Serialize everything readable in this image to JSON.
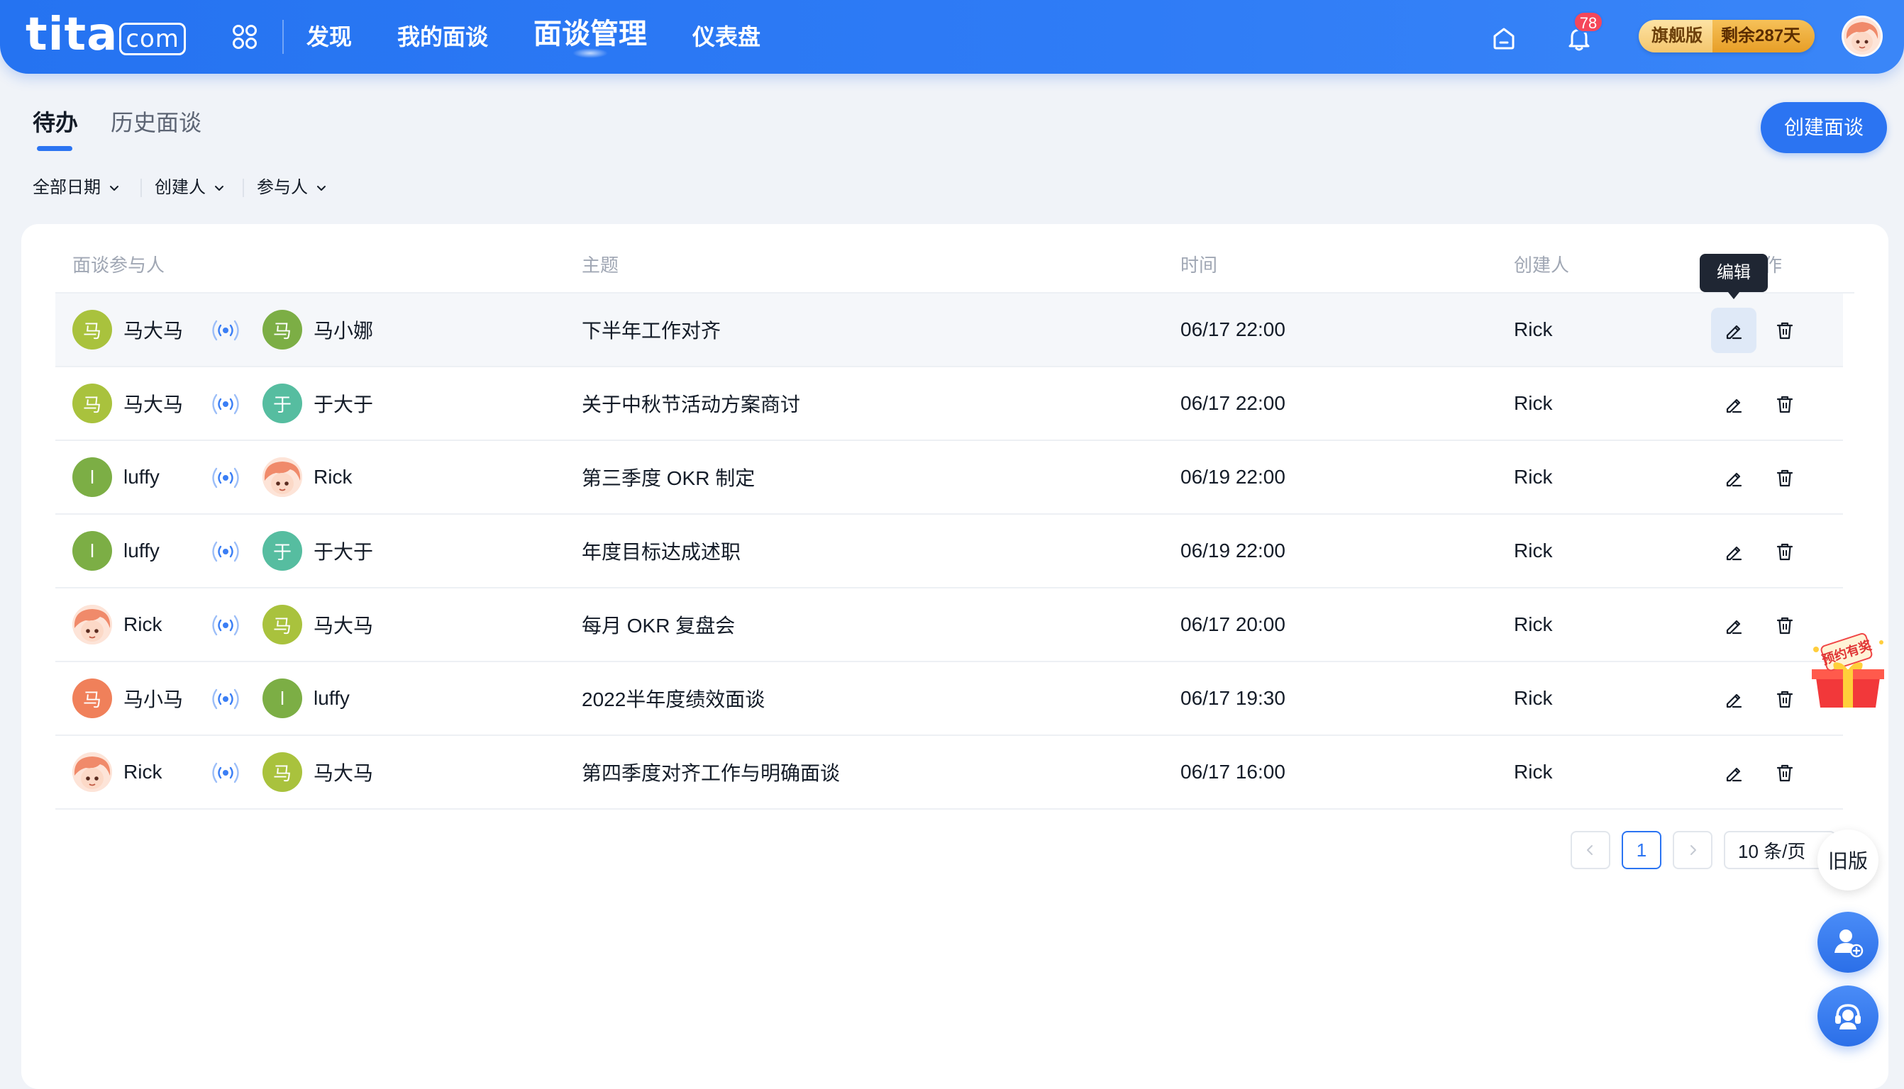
{
  "brand": {
    "logo_text": "tita",
    "logo_domain": "com",
    "accent": "#2b74f2"
  },
  "nav": {
    "items": [
      {
        "label": "发现"
      },
      {
        "label": "我的面谈"
      },
      {
        "label": "面谈管理",
        "active": true
      },
      {
        "label": "仪表盘"
      }
    ],
    "notification_count": "78",
    "plan_label": "旗舰版",
    "plan_remaining": "剩余287天"
  },
  "tabs": [
    {
      "label": "待办",
      "active": true
    },
    {
      "label": "历史面谈",
      "active": false
    }
  ],
  "create_button": "创建面谈",
  "filters": [
    {
      "label": "全部日期"
    },
    {
      "label": "创建人"
    },
    {
      "label": "参与人"
    }
  ],
  "table": {
    "headers": {
      "participants": "面谈参与人",
      "topic": "主题",
      "time": "时间",
      "creator": "创建人",
      "ops_tail": "作"
    },
    "tooltip": "编辑",
    "rows": [
      {
        "p1": {
          "initial": "马",
          "name": "马大马",
          "color": "olive"
        },
        "p2": {
          "initial": "马",
          "name": "马小娜",
          "color": "darkgreen"
        },
        "topic": "下半年工作对齐",
        "time": "06/17 22:00",
        "creator": "Rick"
      },
      {
        "p1": {
          "initial": "马",
          "name": "马大马",
          "color": "olive"
        },
        "p2": {
          "initial": "于",
          "name": "于大于",
          "color": "teal"
        },
        "topic": "关于中秋节活动方案商讨",
        "time": "06/17 22:00",
        "creator": "Rick"
      },
      {
        "p1": {
          "initial": "l",
          "name": "luffy",
          "color": "darkgreen"
        },
        "p2": {
          "initial": "",
          "name": "Rick",
          "color": "photo"
        },
        "topic": "第三季度 OKR 制定",
        "time": "06/19 22:00",
        "creator": "Rick"
      },
      {
        "p1": {
          "initial": "l",
          "name": "luffy",
          "color": "darkgreen"
        },
        "p2": {
          "initial": "于",
          "name": "于大于",
          "color": "teal"
        },
        "topic": "年度目标达成述职",
        "time": "06/19 22:00",
        "creator": "Rick"
      },
      {
        "p1": {
          "initial": "",
          "name": "Rick",
          "color": "photo"
        },
        "p2": {
          "initial": "马",
          "name": "马大马",
          "color": "olive"
        },
        "topic": "每月 OKR 复盘会",
        "time": "06/17 20:00",
        "creator": "Rick"
      },
      {
        "p1": {
          "initial": "马",
          "name": "马小马",
          "color": "orange"
        },
        "p2": {
          "initial": "l",
          "name": "luffy",
          "color": "darkgreen"
        },
        "topic": "2022半年度绩效面谈",
        "time": "06/17 19:30",
        "creator": "Rick"
      },
      {
        "p1": {
          "initial": "",
          "name": "Rick",
          "color": "photo"
        },
        "p2": {
          "initial": "马",
          "name": "马大马",
          "color": "olive"
        },
        "topic": "第四季度对齐工作与明确面谈",
        "time": "06/17 16:00",
        "creator": "Rick"
      }
    ]
  },
  "pagination": {
    "current_page": "1",
    "page_size": "10 条/页"
  },
  "floating": {
    "old_version": "旧版",
    "gift_text": "预约有奖"
  }
}
